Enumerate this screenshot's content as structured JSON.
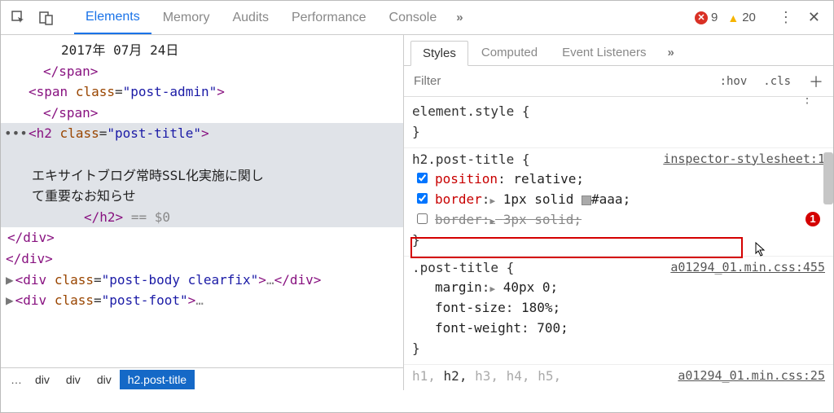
{
  "topbar": {
    "tabs": [
      "Elements",
      "Memory",
      "Audits",
      "Performance",
      "Console"
    ],
    "active_tab": 0,
    "errors": "9",
    "warnings": "20"
  },
  "dom": {
    "line1_text": "2017年 07月 24日",
    "line2": "</span>",
    "line3_open": "<span class=\"post-admin\">",
    "line4": "</span>",
    "line5_open": "<h2 class=\"post-title\">",
    "line6_blank": "",
    "line7_text": "エキサイトブログ常時SSL化実施に関して重要なお知らせ",
    "line8_close": "</h2>",
    "line8_eq": "== $0",
    "line9": "</div>",
    "line10": "</div>",
    "line11": "<div class=\"post-body clearfix\">…</div>",
    "line12": "<div class=\"post-foot\">…"
  },
  "breadcrumb": {
    "items": [
      "…",
      "div",
      "div",
      "div",
      "h2.post-title"
    ],
    "selected": 4
  },
  "styles_tabs": {
    "items": [
      "Styles",
      "Computed",
      "Event Listeners"
    ],
    "active": 0
  },
  "filter": {
    "placeholder": "Filter",
    "hov": ":hov",
    "cls": ".cls"
  },
  "rules": {
    "r0": {
      "selector": "element.style {",
      "close": "}"
    },
    "r1": {
      "selector": "h2.post-title {",
      "source": "inspector-stylesheet:1",
      "p1_name": "position",
      "p1_val": "relative;",
      "p2_name": "border",
      "p2_tri": "▶",
      "p2_val": "1px solid ",
      "p2_color": "#aaa;",
      "p3_name": "border",
      "p3_tri": "▶",
      "p3_val": "3px solid;",
      "close": "}"
    },
    "r2": {
      "selector": ".post-title {",
      "source": "a01294_01.min.css:455",
      "p1_name": "margin",
      "p1_tri": "▶",
      "p1_val": "40px 0;",
      "p2_name": "font-size",
      "p2_val": "180%;",
      "p3_name": "font-weight",
      "p3_val": "700;",
      "close": "}"
    },
    "r3": {
      "selector_parts": [
        "h1,",
        "h2,",
        "h3,",
        "h4,",
        "h5,"
      ],
      "source": "a01294_01.min.css:25"
    }
  },
  "badge": "1"
}
